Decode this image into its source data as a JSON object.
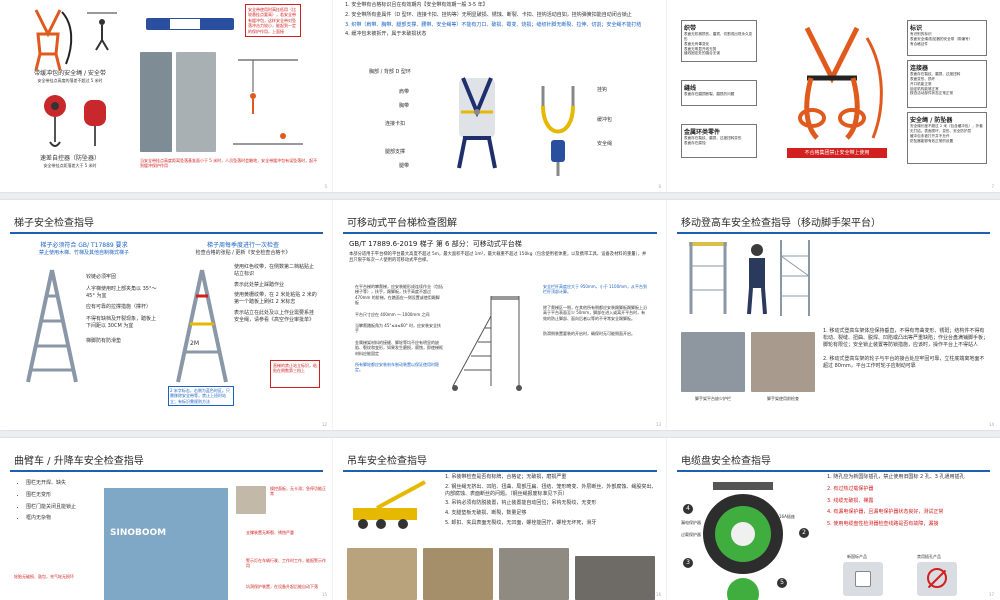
{
  "slide1": {
    "caption_left": "带缓冲包的安全绳 / 安全带",
    "caption_left_sub": "安全带挂点高度的落差不超过 5 米时",
    "caption_left2": "速差自控器（防坠器）",
    "caption_left2_sub": "安全带挂点距落差大于 5 米时",
    "note_box": "安全带使用时高挂低用（比较悬挂点要高），若安全带有缓冲包，这样安全带对坠落冲击力较小，能起到一定的保护作用，上面接",
    "bottom_caption": "当安全带挂点高度距离坠落基准面小于 5 米时，人员坠落时会触地，安全带缓冲包有误坠落时，起不到缓冲保护作用",
    "page": "5"
  },
  "slide2": {
    "items": [
      "1. 安全带有合格标识且在有效期内【安全带有效期一般 3-5 年】",
      "2. 安全带所有金属件（D 型环、连接卡扣、挂钩等）无明显破损、锈蚀、断裂、卡扣、挂钩活动自如，挂钩弹簧扣能自动闭合锁止",
      "3. 织带（肩带、胸带、腿部支撑、腰带、安全绳等）不能有刀口、破损、霉变、烧损；缝纫针脚无断裂、拉伸、切割；安全绳不能打结",
      "4. 缓冲包未被拆开，属于未破损状态"
    ],
    "labels_left": [
      "胸部 / 背部 D 型环",
      "肩带",
      "胸带",
      "连接卡扣",
      "腿部支撑",
      "腿带"
    ],
    "labels_right": [
      "挂钩",
      "缓冲包",
      "安全绳"
    ],
    "page": "6"
  },
  "slide3": {
    "card_webbing_title": "织带",
    "card_webbing": [
      "表面无机械损伤、磨损、切割或出现永久变形",
      "表面无有毒变化",
      "表面无明显开线无剪",
      "缝线固定处的缝合无误"
    ],
    "card_sign_title": "标识",
    "card_sign": [
      "有识别的标识",
      "表面安全绳/阻尼器的安全带（带编号）",
      "有合格证件"
    ],
    "card_connector_title": "连接器",
    "card_connector": [
      "表面存在裂纹、磨损、过度扭转",
      "表面变形、损坏",
      "开口机能正常",
      "锁定机构能够正常",
      "核查活动部件状态正常正常"
    ],
    "card_seam_title": "缝线",
    "card_seam": [
      "表面存在磨损断裂、磨损的问题"
    ],
    "card_metal_title": "金属环类零件",
    "card_metal": [
      "表面存在裂纹、磨损、过度扭转变形",
      "表面存在腐蚀"
    ],
    "card_lanyard_title": "安全绳 / 防坠器",
    "card_lanyard": [
      "安全绳长度不超过 2 米（包含缓冲包），外套无打结，表面损坏、变形、安全防护层",
      "缓冲包未被打开并不允许",
      "防坠器能够有效正常的设置"
    ],
    "warning": "不合格集团禁止安全带上使用",
    "page": "7"
  },
  "slide4": {
    "title": "梯子安全检查指导",
    "left_header": "梯子必须符合 GB/ T17889 要求",
    "left_sub": "禁止使用木梯、竹梯及其他自制梯式梯子",
    "right_header": "梯子周每季度进行一次检查",
    "right_sub": "检查合格的张贴 / 更新《安全检查合格卡》",
    "left_notes": [
      "铰链必须牢固",
      "人字梯使用时上部夹角以 35°～45° 为宜",
      "应有可靠的拉撑措施（撑杆）",
      "不得有缺档及开裂现象，踏板上下间距以 30CM 为宜",
      "梯脚防有防滑垫"
    ],
    "right_notes": [
      "使用红色纹带，在侧数第二档粘贴止站立标识",
      "表示此处禁止踩踏作业",
      "使用黄栅纹带，在 2 米处粘贴 2 米的第一个踏板上刷红 2 米标志",
      "表示站立在此处及以上作业需要系挂安全绳，请参看《高空作业审批单》",
      "直梯的禁止站立标识，粘贴在倒数第三档上"
    ],
    "foot_note": "2 米字标志，右侧为蓝色时区。只需移除安全带等，禁止上班时站立；有标识需规则方法",
    "ladder_mark": "2M",
    "page": "12"
  },
  "slide5": {
    "title": "可移动式平台梯检查图解",
    "std": "GB/T 17889.6-2019 梯子 第 6 部分：可移动式平台梯",
    "intro": "本部分适用于平台梯的平台最大高度不超过 5m，最大面积不超过 1m²，最大载重不超过 150kg（包含使用者体重，以及携带工具、设备及材料的重量），并且只限于每次一人使用的可移动式平台梯。",
    "left_notes": [
      "在平台梯的攀爬梯，应安装能形成连续作业（包括梯子等），扶手，踢脚板，扶手高度不超过 470mm 的阶梯，在踏面应一侧设置或使用踢脚板",
      "平台尺寸应在 400mm ～ 1000mm 之间",
      "当攀爬踏板角为 45°≤α≤60° 时，应安装安全扶手",
      "金属梯架材料的接缝、脚轮等均不应有明显的缺陷、裂纹和变形，如果发生磨损，腐蚀，即使梯框材料应能固定",
      "所有脚轮都应安装刹车制动装置以保证使用时稳定。"
    ],
    "right_notes": [
      "安全栏杆高度应大于 950mm，小于 1100mm，从平台到栏杆顶部计算。",
      "除了爬梯区一侧，在其他所有侧都应安装踢脚板踢脚板上沿高于平台表面至少 50mm，脚部在进入或离开平台时，有效的防止脚部、面向后者以等的不寻常安全踢脚板。",
      "防滑侧装置要装的开启时，确保时无可能侧面开启。"
    ],
    "page": "13"
  },
  "slide6": {
    "title": "移动登高车安全检查指导（移动脚手架平台）",
    "cap1": "脚手架平台缺少护栏",
    "cap2": "脚手架使用前检查",
    "items": [
      "1. 移动式登高车架体应保持垂直，不得有弯曲变形、锈斑；结构件不得有松动、裂缝、扭曲、脱焊、凹陷或凸出等严重缺陷；作业台盘满铺脚手板；脚轮有限位；安全锁止装置等防锁措施，应该时，操作平台上不得站人",
      "2. 移动式登高车架的轮子与平台的接合处应牢固可靠，立柱底端离地面不超过 80mm，平台工作时轮子应制动可靠"
    ],
    "page": "14"
  },
  "slide7": {
    "title": "曲臂车 / 升降车安全检查指导",
    "items": [
      "围栏无开焊、缺失",
      "围栏无变形",
      "围栏门能关闭且能锁止",
      "框内无杂物"
    ],
    "callouts": [
      "操控面板，无卡滞；急停功能正常",
      "支撑装置无断裂、锈蚀严重",
      "警示灯在车辆行驶、工作时工作，能报警示作用",
      "坑洞保护装置，在设备升起后能自动下落"
    ],
    "bottom_left": "轮胎无破损、鼓包，充气轮无损坏",
    "brand": "SINOBOOM",
    "page": "15"
  },
  "slide8": {
    "title": "吊车安全检查指导",
    "items": [
      "1. 吊装带检查是否有标牌，合格证；无破损，磨损严重",
      "2. 钢丝绳无挤出、凹陷、扭曲、局部压扁、扭结、笼形畸变、外层断丝、外部腐蚀、绳股突出、内部腐蚀、表面断丝的问题。（钢丝绳报废标准见下页）",
      "3. 吊钩必须有防脱装置，钩止装置能自动回位；吊钩无裂纹，无变形",
      "4. 支腿垫板无破损、断裂，数量足够",
      "5. 卸扣、夹具表面无裂纹，无凹面，螺栓能回拧，螺栓无坏死，滑牙"
    ],
    "page": "16"
  },
  "slide9": {
    "title": "电缆盘安全检查指导",
    "items": [
      "1. 随孔应为新国际插孔，禁止使用旧国标 2 孔、3 孔通用插孔",
      "2. 有过热过载保护器",
      "3. 线缆无破损、裸露",
      "4. 有漏电保护器，且漏电保护器状态良好，测试正常",
      "5. 使用电缆盘性检测器检查线路是否有故障，漏接"
    ],
    "legend_new": "新国标产品",
    "legend_old": "禁用插孔产品",
    "callouts": [
      "漏电保护器",
      "过载保护器",
      "16A插座"
    ],
    "markers": [
      "4",
      "2",
      "3",
      "5"
    ],
    "page": "17"
  },
  "colors": {
    "accent": "#1d5fb0",
    "danger": "#d21f1f",
    "harness": "#e05a1e"
  }
}
